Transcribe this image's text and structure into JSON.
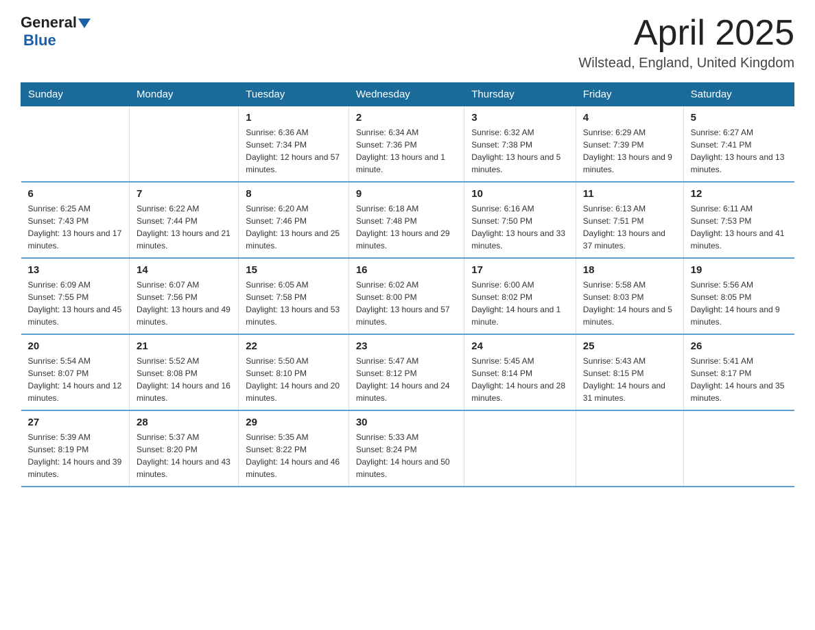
{
  "header": {
    "logo_general": "General",
    "logo_blue": "Blue",
    "title": "April 2025",
    "location": "Wilstead, England, United Kingdom"
  },
  "weekdays": [
    "Sunday",
    "Monday",
    "Tuesday",
    "Wednesday",
    "Thursday",
    "Friday",
    "Saturday"
  ],
  "weeks": [
    [
      {
        "day": "",
        "sunrise": "",
        "sunset": "",
        "daylight": ""
      },
      {
        "day": "",
        "sunrise": "",
        "sunset": "",
        "daylight": ""
      },
      {
        "day": "1",
        "sunrise": "Sunrise: 6:36 AM",
        "sunset": "Sunset: 7:34 PM",
        "daylight": "Daylight: 12 hours and 57 minutes."
      },
      {
        "day": "2",
        "sunrise": "Sunrise: 6:34 AM",
        "sunset": "Sunset: 7:36 PM",
        "daylight": "Daylight: 13 hours and 1 minute."
      },
      {
        "day": "3",
        "sunrise": "Sunrise: 6:32 AM",
        "sunset": "Sunset: 7:38 PM",
        "daylight": "Daylight: 13 hours and 5 minutes."
      },
      {
        "day": "4",
        "sunrise": "Sunrise: 6:29 AM",
        "sunset": "Sunset: 7:39 PM",
        "daylight": "Daylight: 13 hours and 9 minutes."
      },
      {
        "day": "5",
        "sunrise": "Sunrise: 6:27 AM",
        "sunset": "Sunset: 7:41 PM",
        "daylight": "Daylight: 13 hours and 13 minutes."
      }
    ],
    [
      {
        "day": "6",
        "sunrise": "Sunrise: 6:25 AM",
        "sunset": "Sunset: 7:43 PM",
        "daylight": "Daylight: 13 hours and 17 minutes."
      },
      {
        "day": "7",
        "sunrise": "Sunrise: 6:22 AM",
        "sunset": "Sunset: 7:44 PM",
        "daylight": "Daylight: 13 hours and 21 minutes."
      },
      {
        "day": "8",
        "sunrise": "Sunrise: 6:20 AM",
        "sunset": "Sunset: 7:46 PM",
        "daylight": "Daylight: 13 hours and 25 minutes."
      },
      {
        "day": "9",
        "sunrise": "Sunrise: 6:18 AM",
        "sunset": "Sunset: 7:48 PM",
        "daylight": "Daylight: 13 hours and 29 minutes."
      },
      {
        "day": "10",
        "sunrise": "Sunrise: 6:16 AM",
        "sunset": "Sunset: 7:50 PM",
        "daylight": "Daylight: 13 hours and 33 minutes."
      },
      {
        "day": "11",
        "sunrise": "Sunrise: 6:13 AM",
        "sunset": "Sunset: 7:51 PM",
        "daylight": "Daylight: 13 hours and 37 minutes."
      },
      {
        "day": "12",
        "sunrise": "Sunrise: 6:11 AM",
        "sunset": "Sunset: 7:53 PM",
        "daylight": "Daylight: 13 hours and 41 minutes."
      }
    ],
    [
      {
        "day": "13",
        "sunrise": "Sunrise: 6:09 AM",
        "sunset": "Sunset: 7:55 PM",
        "daylight": "Daylight: 13 hours and 45 minutes."
      },
      {
        "day": "14",
        "sunrise": "Sunrise: 6:07 AM",
        "sunset": "Sunset: 7:56 PM",
        "daylight": "Daylight: 13 hours and 49 minutes."
      },
      {
        "day": "15",
        "sunrise": "Sunrise: 6:05 AM",
        "sunset": "Sunset: 7:58 PM",
        "daylight": "Daylight: 13 hours and 53 minutes."
      },
      {
        "day": "16",
        "sunrise": "Sunrise: 6:02 AM",
        "sunset": "Sunset: 8:00 PM",
        "daylight": "Daylight: 13 hours and 57 minutes."
      },
      {
        "day": "17",
        "sunrise": "Sunrise: 6:00 AM",
        "sunset": "Sunset: 8:02 PM",
        "daylight": "Daylight: 14 hours and 1 minute."
      },
      {
        "day": "18",
        "sunrise": "Sunrise: 5:58 AM",
        "sunset": "Sunset: 8:03 PM",
        "daylight": "Daylight: 14 hours and 5 minutes."
      },
      {
        "day": "19",
        "sunrise": "Sunrise: 5:56 AM",
        "sunset": "Sunset: 8:05 PM",
        "daylight": "Daylight: 14 hours and 9 minutes."
      }
    ],
    [
      {
        "day": "20",
        "sunrise": "Sunrise: 5:54 AM",
        "sunset": "Sunset: 8:07 PM",
        "daylight": "Daylight: 14 hours and 12 minutes."
      },
      {
        "day": "21",
        "sunrise": "Sunrise: 5:52 AM",
        "sunset": "Sunset: 8:08 PM",
        "daylight": "Daylight: 14 hours and 16 minutes."
      },
      {
        "day": "22",
        "sunrise": "Sunrise: 5:50 AM",
        "sunset": "Sunset: 8:10 PM",
        "daylight": "Daylight: 14 hours and 20 minutes."
      },
      {
        "day": "23",
        "sunrise": "Sunrise: 5:47 AM",
        "sunset": "Sunset: 8:12 PM",
        "daylight": "Daylight: 14 hours and 24 minutes."
      },
      {
        "day": "24",
        "sunrise": "Sunrise: 5:45 AM",
        "sunset": "Sunset: 8:14 PM",
        "daylight": "Daylight: 14 hours and 28 minutes."
      },
      {
        "day": "25",
        "sunrise": "Sunrise: 5:43 AM",
        "sunset": "Sunset: 8:15 PM",
        "daylight": "Daylight: 14 hours and 31 minutes."
      },
      {
        "day": "26",
        "sunrise": "Sunrise: 5:41 AM",
        "sunset": "Sunset: 8:17 PM",
        "daylight": "Daylight: 14 hours and 35 minutes."
      }
    ],
    [
      {
        "day": "27",
        "sunrise": "Sunrise: 5:39 AM",
        "sunset": "Sunset: 8:19 PM",
        "daylight": "Daylight: 14 hours and 39 minutes."
      },
      {
        "day": "28",
        "sunrise": "Sunrise: 5:37 AM",
        "sunset": "Sunset: 8:20 PM",
        "daylight": "Daylight: 14 hours and 43 minutes."
      },
      {
        "day": "29",
        "sunrise": "Sunrise: 5:35 AM",
        "sunset": "Sunset: 8:22 PM",
        "daylight": "Daylight: 14 hours and 46 minutes."
      },
      {
        "day": "30",
        "sunrise": "Sunrise: 5:33 AM",
        "sunset": "Sunset: 8:24 PM",
        "daylight": "Daylight: 14 hours and 50 minutes."
      },
      {
        "day": "",
        "sunrise": "",
        "sunset": "",
        "daylight": ""
      },
      {
        "day": "",
        "sunrise": "",
        "sunset": "",
        "daylight": ""
      },
      {
        "day": "",
        "sunrise": "",
        "sunset": "",
        "daylight": ""
      }
    ]
  ]
}
